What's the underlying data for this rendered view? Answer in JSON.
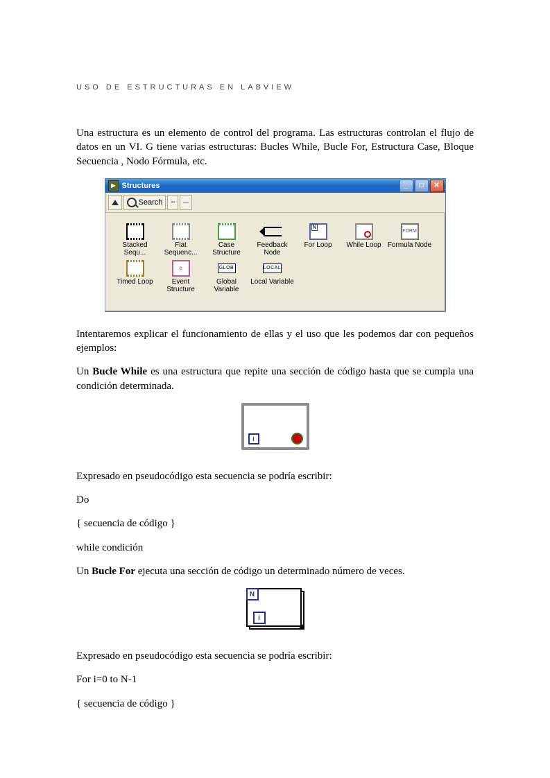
{
  "header": "USO DE ESTRUCTURAS EN LABVIEW",
  "p1": " Una estructura es un elemento de control del programa. Las estructuras controlan el flujo de datos en un VI. G tiene varias estructuras: Bucles While, Bucle For, Estructura Case, Bloque Secuencia , Nodo Fórmula, etc.",
  "window": {
    "title": "Structures",
    "toolbar": {
      "search": "Search"
    },
    "items": [
      {
        "label": "Stacked Sequ..."
      },
      {
        "label": "Flat Sequenc..."
      },
      {
        "label": "Case Structure"
      },
      {
        "label": "Feedback Node"
      },
      {
        "label": "For Loop"
      },
      {
        "label": "While Loop"
      },
      {
        "label": "Formula Node"
      },
      {
        "label": "Timed Loop"
      },
      {
        "label": "Event Structure"
      },
      {
        "label": "Global Variable"
      },
      {
        "label": "Local Variable"
      }
    ],
    "globText": "GLOB",
    "localText": "LOCAL",
    "formulaText": "FORM"
  },
  "p2": "Intentaremos explicar el funcionamiento de ellas y el uso que les podemos dar con pequeños ejemplos:",
  "p3a": "Un ",
  "p3b": "Bucle While",
  "p3c": " es una estructura que repite una sección de código hasta que se cumpla una condición determinada.",
  "p4": "Expresado en pseudocódigo esta secuencia se podría escribir:",
  "p5": "Do",
  "p6": "{     secuencia de código     }",
  "p7": "while condición",
  "p8a": "Un ",
  "p8b": "Bucle For",
  "p8c": " ejecuta una sección de código un determinado número de veces.",
  "p9": "Expresado en pseudocódigo esta secuencia se podría escribir:",
  "p10": "For i=0 to N-1",
  "p11": "{      secuencia de código   }",
  "whileFig": {
    "i": "i"
  },
  "forFig": {
    "n": "N",
    "i": "i"
  }
}
